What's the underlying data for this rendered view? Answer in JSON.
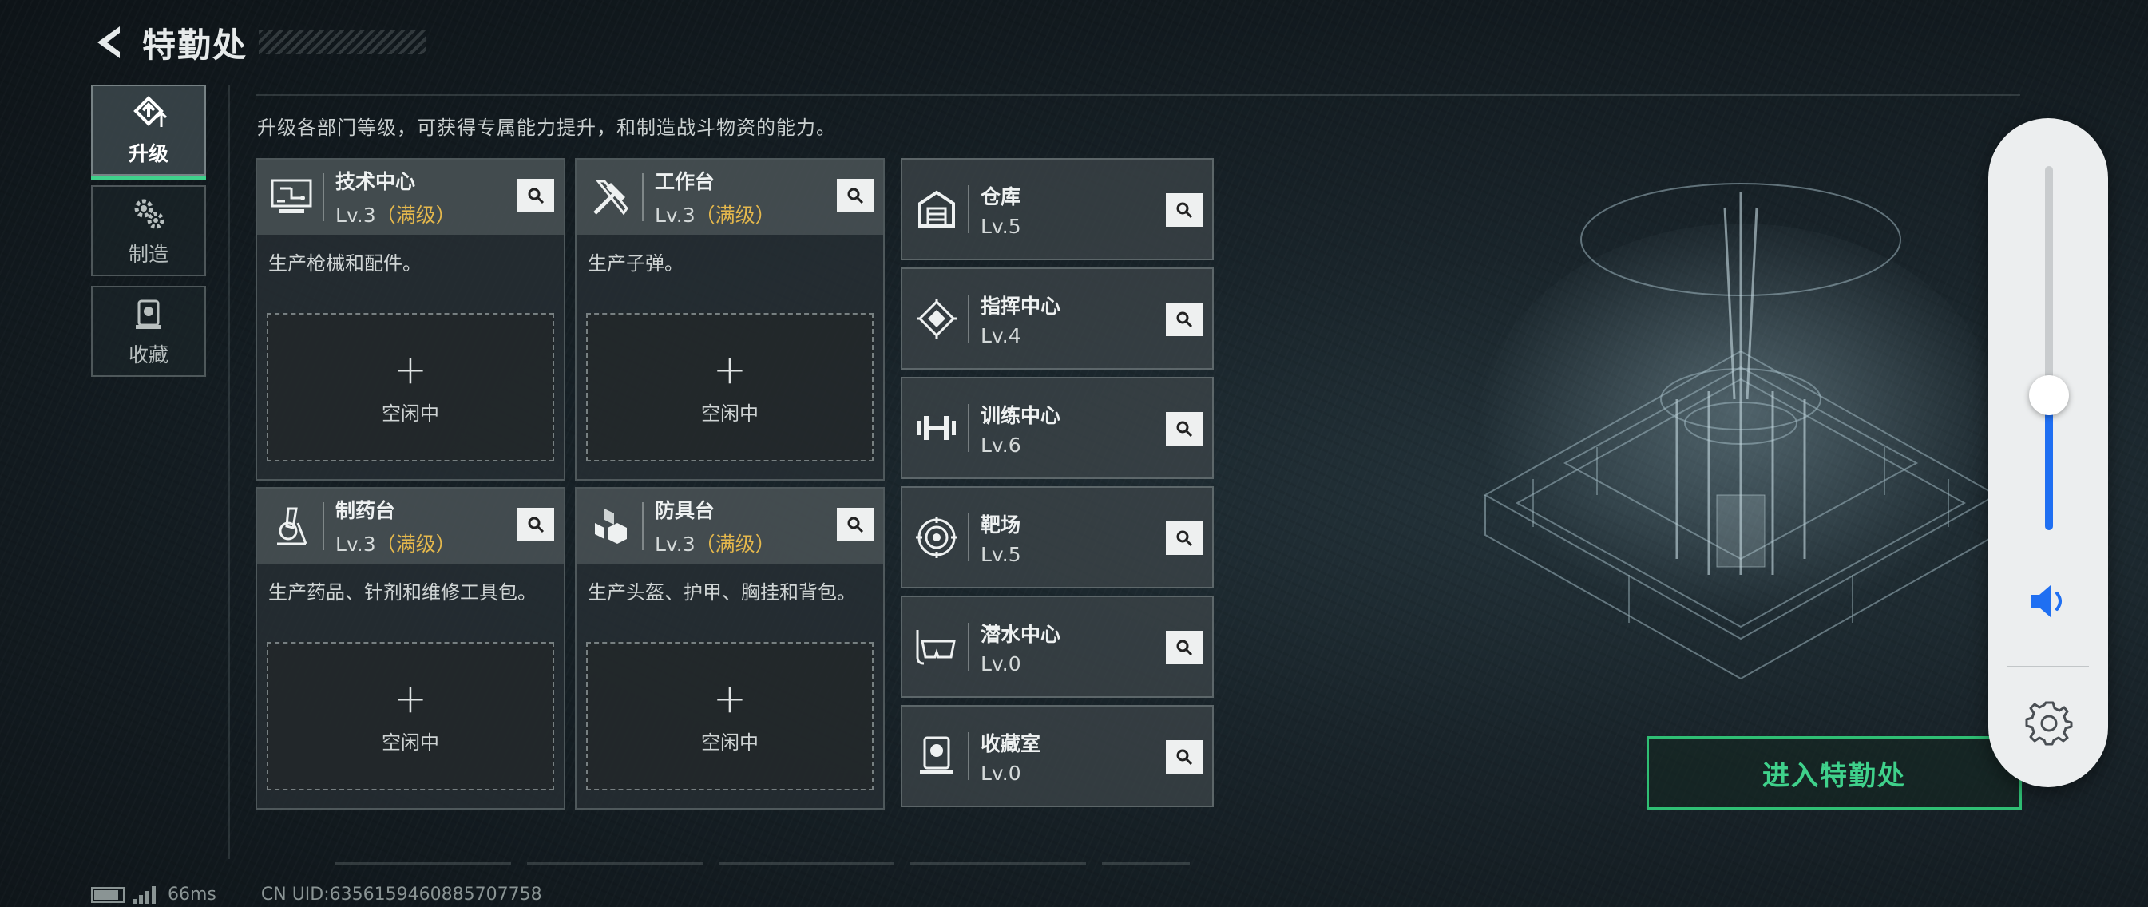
{
  "header": {
    "title": "特勤处",
    "back_icon": "chevron-left-icon"
  },
  "nav": [
    {
      "label": "升级",
      "icon": "upgrade-icon",
      "active": true
    },
    {
      "label": "制造",
      "icon": "gears-icon",
      "active": false
    },
    {
      "label": "收藏",
      "icon": "collection-icon",
      "active": false
    }
  ],
  "intro": "升级各部门等级，可获得专属能力提升，和制造战斗物资的能力。",
  "cards": [
    {
      "name": "技术中心",
      "level": "Lv.3",
      "maxed": "（满级）",
      "icon": "tech-center-icon",
      "desc": "生产枪械和配件。",
      "slot_plus": "+",
      "slot_label": "空闲中"
    },
    {
      "name": "工作台",
      "level": "Lv.3",
      "maxed": "（满级）",
      "icon": "workbench-icon",
      "desc": "生产子弹。",
      "slot_plus": "+",
      "slot_label": "空闲中"
    },
    {
      "name": "制药台",
      "level": "Lv.3",
      "maxed": "（满级）",
      "icon": "pharmacy-icon",
      "desc": "生产药品、针剂和维修工具包。",
      "slot_plus": "+",
      "slot_label": "空闲中"
    },
    {
      "name": "防具台",
      "level": "Lv.3",
      "maxed": "（满级）",
      "icon": "armor-bench-icon",
      "desc": "生产头盔、护甲、胸挂和背包。",
      "slot_plus": "+",
      "slot_label": "空闲中"
    }
  ],
  "rows": [
    {
      "name": "仓库",
      "level": "Lv.5",
      "icon": "warehouse-icon"
    },
    {
      "name": "指挥中心",
      "level": "Lv.4",
      "icon": "command-center-icon"
    },
    {
      "name": "训练中心",
      "level": "Lv.6",
      "icon": "dumbbell-icon"
    },
    {
      "name": "靶场",
      "level": "Lv.5",
      "icon": "target-icon"
    },
    {
      "name": "潜水中心",
      "level": "Lv.0",
      "icon": "diving-mask-icon"
    },
    {
      "name": "收藏室",
      "level": "Lv.0",
      "icon": "collection-room-icon"
    }
  ],
  "enter_button": "进入特勤处",
  "volume": {
    "level": 0.37,
    "accent": "#1f6ff2"
  },
  "status": {
    "ping": "66ms",
    "uid": "CN UID:6356159460885707758"
  },
  "colors": {
    "accent_green": "#3fd18b",
    "maxed_gold": "#e5b84c"
  }
}
